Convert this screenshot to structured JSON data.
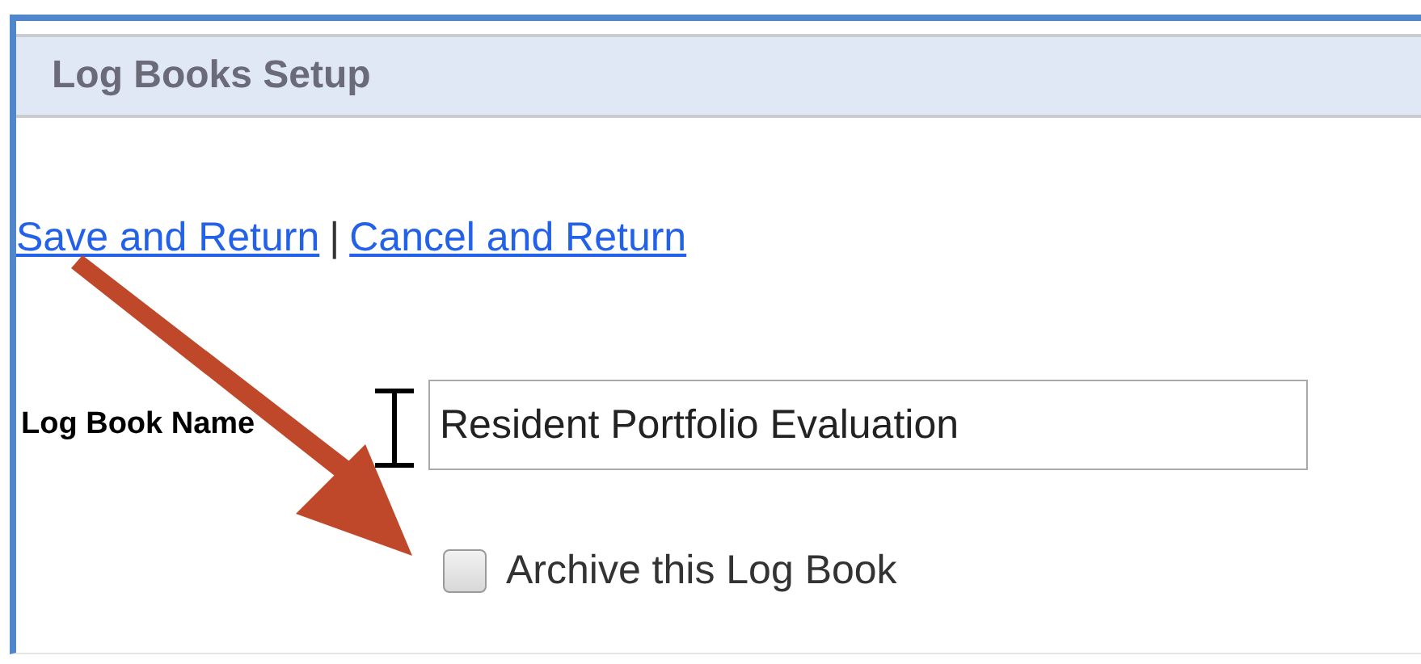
{
  "header": {
    "title": "Log Books Setup"
  },
  "links": [
    {
      "label": "Save and Return"
    },
    {
      "label": "Cancel and Return"
    }
  ],
  "link_separator": "|",
  "name_field": {
    "label": "Log Book Name",
    "value": "Resident Portfolio Evaluation"
  },
  "archive": {
    "label": "Archive this Log Book",
    "checked": false
  }
}
